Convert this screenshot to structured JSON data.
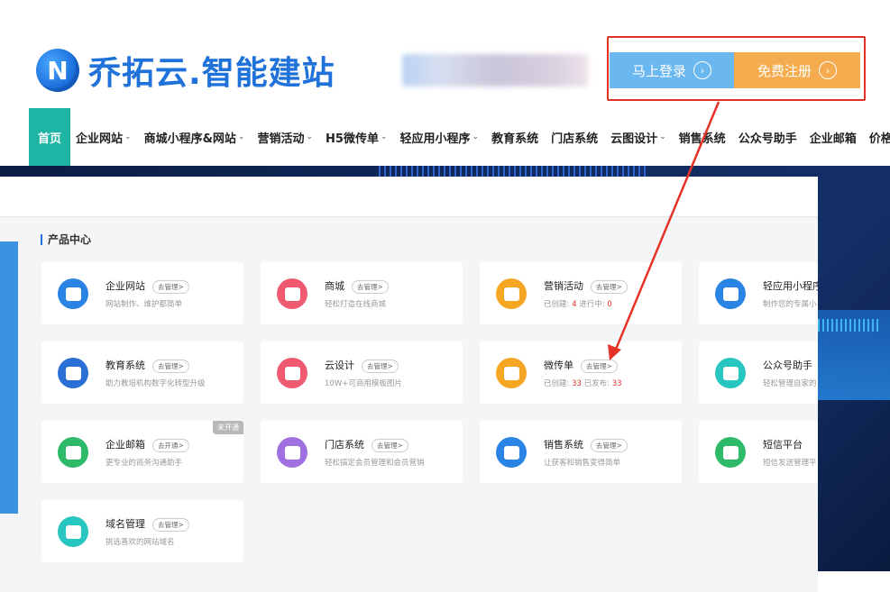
{
  "brand": {
    "logo_letter": "N",
    "name": "乔拓云.智能建站"
  },
  "auth": {
    "login_label": "马上登录",
    "register_label": "免费注册",
    "arrow_glyph": "›"
  },
  "nav": {
    "items": [
      {
        "label": "首页",
        "caret": false
      },
      {
        "label": "企业网站",
        "caret": true
      },
      {
        "label": "商城小程序&网站",
        "caret": true
      },
      {
        "label": "营销活动",
        "caret": true
      },
      {
        "label": "H5微传单",
        "caret": true
      },
      {
        "label": "轻应用小程序",
        "caret": true
      },
      {
        "label": "教育系统",
        "caret": false
      },
      {
        "label": "门店系统",
        "caret": false
      },
      {
        "label": "云图设计",
        "caret": true
      },
      {
        "label": "销售系统",
        "caret": false
      },
      {
        "label": "公众号助手",
        "caret": false
      },
      {
        "label": "企业邮箱",
        "caret": false
      },
      {
        "label": "价格中心",
        "caret": false
      }
    ],
    "caret_glyph": "⌄"
  },
  "products": {
    "section_title": "产品中心",
    "cards": [
      {
        "title": "企业网站",
        "action": "去管理>",
        "sub": "网站制作、维护都简单",
        "color": "#2a84e6",
        "icon": "website-icon"
      },
      {
        "title": "商城",
        "action": "去管理>",
        "sub": "轻松打造在线商城",
        "color": "#ef5a70",
        "icon": "shop-icon"
      },
      {
        "title": "营销活动",
        "action": "去管理>",
        "sub_prefix": "已创建: ",
        "sub_num1": "4",
        "sub_mid": "   进行中: ",
        "sub_num2": "0",
        "color": "#f5a623",
        "icon": "gift-icon"
      },
      {
        "title": "轻应用小程序",
        "action": "",
        "sub": "制作您的专属小",
        "color": "#2a84e6",
        "icon": "miniapp-icon"
      },
      {
        "title": "教育系统",
        "action": "去管理>",
        "sub": "助力教培机构数字化转型升级",
        "color": "#2a6fd6",
        "icon": "education-icon"
      },
      {
        "title": "云设计",
        "action": "去管理>",
        "sub": "10W+可商用模板图片",
        "color": "#ef5a70",
        "icon": "design-icon"
      },
      {
        "title": "微传单",
        "action": "去管理>",
        "sub_prefix": "已创建: ",
        "sub_num1": "33",
        "sub_mid": "   已发布: ",
        "sub_num2": "33",
        "color": "#f5a623",
        "icon": "flyer-icon"
      },
      {
        "title": "公众号助手",
        "action": "",
        "sub": "轻松管理自家的",
        "color": "#27c6c0",
        "icon": "wechat-icon"
      },
      {
        "title": "企业邮箱",
        "action": "去开通>",
        "sub": "更专业的商务沟通助手",
        "color": "#2dbb6a",
        "icon": "mail-icon",
        "badge": "未开通"
      },
      {
        "title": "门店系统",
        "action": "去管理>",
        "sub": "轻松搞定会员管理和会员营销",
        "color": "#a070e0",
        "icon": "store-icon"
      },
      {
        "title": "销售系统",
        "action": "去管理>",
        "sub": "让获客和销售变得简单",
        "color": "#2a84e6",
        "icon": "list-icon"
      },
      {
        "title": "短信平台",
        "action": "",
        "sub": "短信发送管理平",
        "color": "#2dbb6a",
        "icon": "sms-icon"
      },
      {
        "title": "域名管理",
        "action": "去管理>",
        "sub": "挑选喜欢的网站域名",
        "color": "#27c6c0",
        "icon": "domain-icon"
      }
    ]
  },
  "colors": {
    "annotation": "#e53228",
    "nav_active": "#1fb5a5",
    "brand": "#1f72d9"
  }
}
